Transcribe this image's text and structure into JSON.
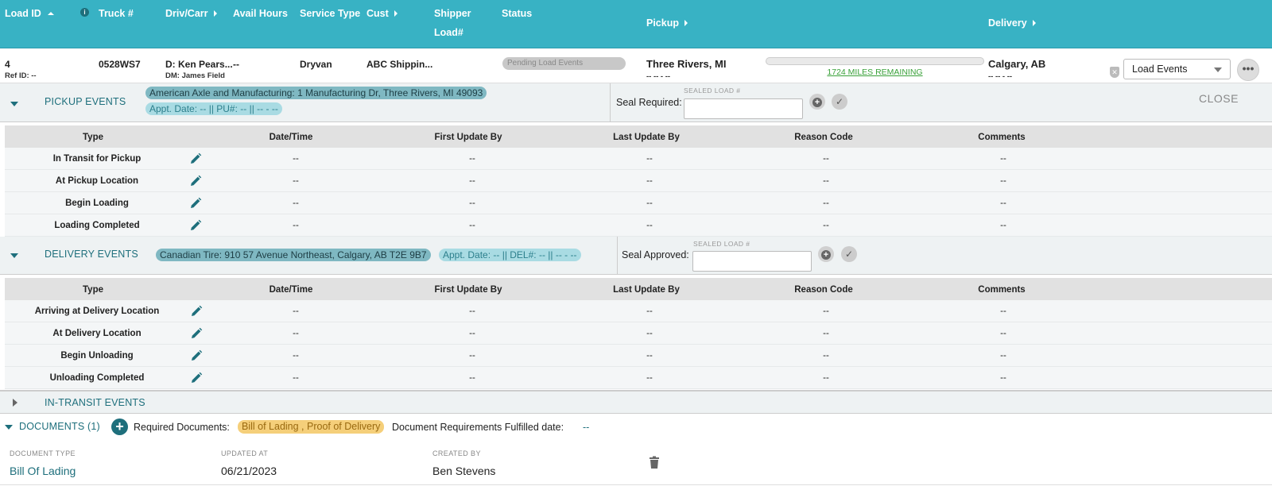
{
  "header": {
    "load_id": "Load ID",
    "truck": "Truck #",
    "driv_carr": "Driv/Carr",
    "avail_hours": "Avail Hours",
    "service_type": "Service Type",
    "cust": "Cust",
    "shipper": "Shipper",
    "load_num": "Load#",
    "status": "Status",
    "pickup": "Pickup",
    "delivery": "Delivery"
  },
  "load": {
    "id": "4",
    "ref_id": "Ref ID: --",
    "truck": "0528WS7",
    "driver": "D: Ken Pears...",
    "dm": "DM: James Field",
    "avail_hours": "--",
    "service_type": "Dryvan",
    "customer": "ABC Shippin...",
    "status": "Pending Load Events",
    "pickup_city": "Three Rivers, MI",
    "pickup_date": "-- -- - --",
    "progress_fraction": 0.0,
    "miles_remaining": "1724 MILES REMAINING",
    "delivery_city": "Calgary, AB",
    "delivery_date": "-- -- - --",
    "events_select": "Load Events",
    "more": "•••"
  },
  "pickup_events": {
    "title": "PICKUP EVENTS",
    "address": "American Axle and Manufacturing: 1 Manufacturing Dr, Three Rivers, MI 49093",
    "appt": "Appt. Date: -- || PU#: -- || -- - --",
    "seal_label": "Seal Required:",
    "sealed_caption": "SEALED LOAD #",
    "close": "CLOSE",
    "rows": [
      {
        "type": "In Transit for Pickup",
        "datetime": "--",
        "first": "--",
        "last": "--",
        "reason": "--",
        "comments": "--"
      },
      {
        "type": "At Pickup Location",
        "datetime": "--",
        "first": "--",
        "last": "--",
        "reason": "--",
        "comments": "--"
      },
      {
        "type": "Begin Loading",
        "datetime": "--",
        "first": "--",
        "last": "--",
        "reason": "--",
        "comments": "--"
      },
      {
        "type": "Loading Completed",
        "datetime": "--",
        "first": "--",
        "last": "--",
        "reason": "--",
        "comments": "--"
      }
    ]
  },
  "delivery_events": {
    "title": "DELIVERY EVENTS",
    "address": "Canadian Tire: 910 57 Avenue Northeast, Calgary, AB T2E 9B7",
    "appt": "Appt. Date: -- || DEL#: -- || -- - --",
    "seal_label": "Seal Approved:",
    "sealed_caption": "SEALED LOAD #",
    "rows": [
      {
        "type": "Arriving at Delivery Location",
        "datetime": "--",
        "first": "--",
        "last": "--",
        "reason": "--",
        "comments": "--"
      },
      {
        "type": "At Delivery Location",
        "datetime": "--",
        "first": "--",
        "last": "--",
        "reason": "--",
        "comments": "--"
      },
      {
        "type": "Begin Unloading",
        "datetime": "--",
        "first": "--",
        "last": "--",
        "reason": "--",
        "comments": "--"
      },
      {
        "type": "Unloading Completed",
        "datetime": "--",
        "first": "--",
        "last": "--",
        "reason": "--",
        "comments": "--"
      }
    ]
  },
  "table_columns": {
    "type": "Type",
    "datetime": "Date/Time",
    "first": "First Update By",
    "last": "Last Update By",
    "reason": "Reason Code",
    "comments": "Comments"
  },
  "in_transit": {
    "title": "IN-TRANSIT EVENTS"
  },
  "documents": {
    "title": "DOCUMENTS (1)",
    "required_label": "Required Documents:",
    "required_value": "Bill of Lading , Proof of Delivery",
    "fulfilled_label": "Document Requirements Fulfilled date:",
    "fulfilled_value": "--",
    "col_type": "DOCUMENT TYPE",
    "col_updated": "UPDATED AT",
    "col_created": "CREATED BY",
    "doc_type": "Bill Of Lading",
    "updated_at": "06/21/2023",
    "created_by": "Ben Stevens"
  },
  "colors": {
    "header_bg": "#38b2c4",
    "accent": "#1e6f7c",
    "required_chip": "#f5cf7a",
    "miles_green": "#3aa13a"
  }
}
